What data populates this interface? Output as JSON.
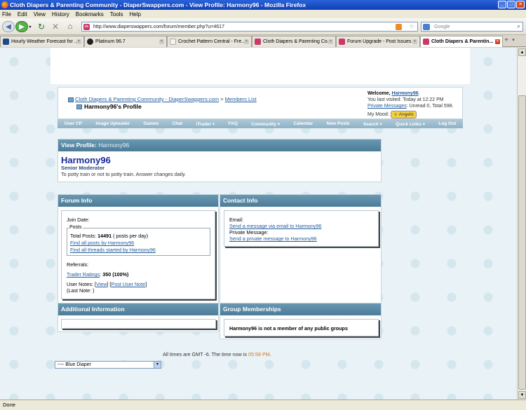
{
  "window": {
    "title": "Cloth Diapers & Parenting Community - DiaperSwappers.com - View Profile: Harmony96 - Mozilla Firefox"
  },
  "menu": [
    "File",
    "Edit",
    "View",
    "History",
    "Bookmarks",
    "Tools",
    "Help"
  ],
  "nav": {
    "url": "http://www.diaperswappers.com/forum/member.php?u=4617",
    "search_placeholder": "Google"
  },
  "tabs": [
    {
      "label": "Hourly Weather Forecast for ...",
      "fav": "#1e4b8f",
      "active": false
    },
    {
      "label": "Platinum 96.7",
      "fav": "#222222",
      "active": false
    },
    {
      "label": "Crochet Pattern Central - Fre...",
      "fav": "#e7e4da",
      "active": false
    },
    {
      "label": "Cloth Diapers & Parenting Co...",
      "fav": "#c93a6a",
      "active": false
    },
    {
      "label": "Forum Upgrade - Post Issues ...",
      "fav": "#c93a6a",
      "active": false
    },
    {
      "label": "Cloth Diapers & Parentin...",
      "fav": "#c93a6a",
      "active": true
    }
  ],
  "header": {
    "breadcrumb_root": "Cloth Diapers & Parenting Community - DiaperSwappers.com",
    "breadcrumb_sep": ">",
    "breadcrumb_members": "Members List",
    "page_title": "Harmony96's Profile",
    "welcome_prefix": "Welcome,",
    "welcome_user": "Harmony96",
    "welcome_suffix": ".",
    "last_visited": "You last visited: Today at 12:22 PM",
    "pm_link": "Private Messages",
    "pm_status": ": Unread 0, Total 598.",
    "mood_label": "My Mood:",
    "mood_value": "Angelic"
  },
  "navstrip": [
    "User CP",
    "Image Uploader",
    "Games",
    "Chat",
    "iTrader ▾",
    "FAQ",
    "Community ▾",
    "Calendar",
    "New Posts",
    "Search ▾",
    "Quick Links ▾",
    "Log Out"
  ],
  "profile": {
    "heading": "View Profile:",
    "heading_user": "Harmony96",
    "username": "Harmony96",
    "title": "Senior Moderator",
    "status": "To potty train or not to potty train. Answer changes daily."
  },
  "forum_info": {
    "heading": "Forum Info",
    "join_date_label": "Join Date:",
    "posts_legend": "Posts",
    "total_posts_label": "Total Posts:",
    "total_posts_value": "14491",
    "posts_per_day": "( posts per day)",
    "find_posts": "Find all posts by Harmony96",
    "find_threads": "Find all threads started by Harmony96",
    "referrals_label": "Referrals:",
    "trader_label": "Trader Ratings",
    "trader_value": "350 (100%)",
    "notes_label": "User Notes:",
    "notes_view": "View",
    "notes_post": "Post User Note",
    "last_note": "(Last Note: )"
  },
  "contact_info": {
    "heading": "Contact Info",
    "email_label": "Email:",
    "email_link": "Send a message via email to Harmony96",
    "pm_label": "Private Message:",
    "pm_link": "Send a private message to Harmony96"
  },
  "additional": {
    "heading": "Additional Information"
  },
  "groups": {
    "heading": "Group Memberships",
    "text": "Harmony96 is not a member of any public groups"
  },
  "footer": {
    "time_prefix": "All times are GMT -6. The time now is",
    "time": "05:58 PM",
    "time_suffix": ".",
    "style_selected": "---- Blue Diaper"
  },
  "statusbar": {
    "text": "Done"
  }
}
